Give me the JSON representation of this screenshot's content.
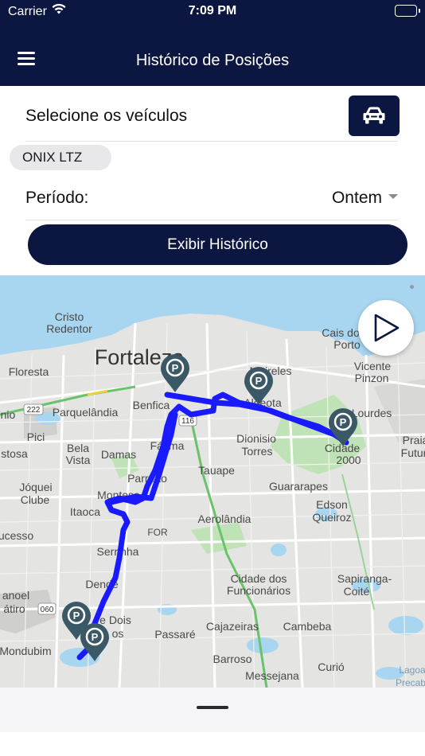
{
  "status_bar": {
    "carrier": "Carrier",
    "time": "7:09 PM"
  },
  "header": {
    "title": "Histórico de Posições",
    "menu_icon": "hamburger-menu-icon"
  },
  "vehicles": {
    "label": "Selecione os veículos",
    "button_icon": "car-icon",
    "selected": [
      "ONIX LTZ"
    ]
  },
  "period": {
    "label": "Período:",
    "value": "Ontem",
    "caret_icon": "chevron-down-icon"
  },
  "show_button": {
    "label": "Exibir Histórico"
  },
  "map": {
    "play_icon": "play-icon",
    "marker_icon": "parking-marker-icon",
    "route_color": "#1a1aff",
    "places": [
      "Cristo",
      "Redentor",
      "Fortaleza",
      "Floresta",
      "Meireles",
      "Aldeota",
      "Cais do",
      "Porto",
      "Vicente",
      "Pinzon",
      "Lourdes",
      "Benfica",
      "Parquelândia",
      "Praia",
      "Futur",
      "Pici",
      "Bela",
      "Vista",
      "Damas",
      "Fátima",
      "Dionísio",
      "Torres",
      "Cidade",
      "2000",
      "stosa",
      "Jóquei",
      "Clube",
      "Parreão",
      "Tauape",
      "Guararapes",
      "Montese",
      "Itaoca",
      "Edson",
      "Queiroz",
      "FOR",
      "Aerolândia",
      "ucesso",
      "Serrinha",
      "Dendê",
      "Cidade dos",
      "Funcionários",
      "Sapiranga-",
      "Coité",
      "anoel",
      "átiro",
      "e Dois",
      "os",
      "Passaré",
      "Cajazeiras",
      "Cambeba",
      "Mondubim",
      "Barroso",
      "Curió",
      "Messejana",
      "Lagoa",
      "Precab",
      "ínio",
      "116",
      "222",
      "060"
    ]
  }
}
